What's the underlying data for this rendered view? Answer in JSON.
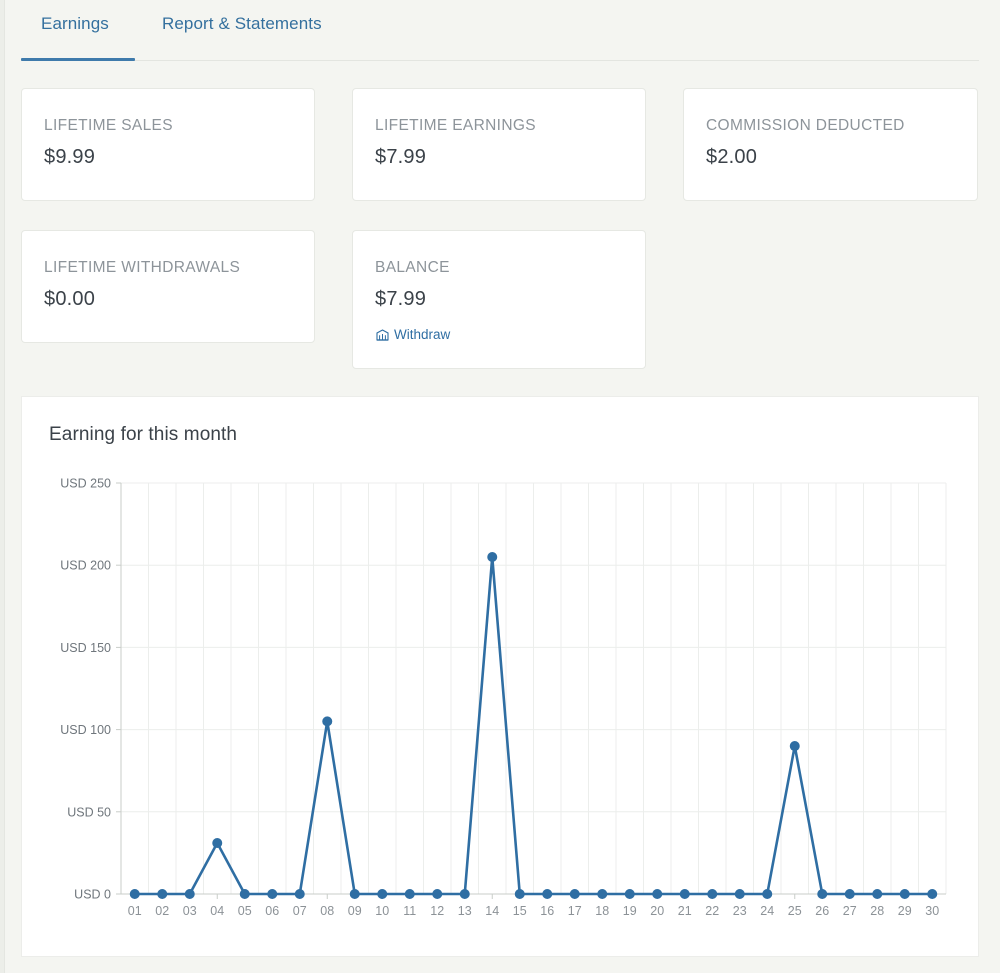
{
  "tabs": [
    {
      "id": "earnings",
      "label": "Earnings",
      "active": true
    },
    {
      "id": "report-statements",
      "label": "Report & Statements",
      "active": false
    }
  ],
  "cards": [
    {
      "id": "lifetime-sales",
      "label": "LIFETIME SALES",
      "value": "$9.99"
    },
    {
      "id": "lifetime-earnings",
      "label": "LIFETIME EARNINGS",
      "value": "$7.99"
    },
    {
      "id": "commission-deducted",
      "label": "COMMISSION DEDUCTED",
      "value": "$2.00"
    },
    {
      "id": "lifetime-withdrawals",
      "label": "LIFETIME WITHDRAWALS",
      "value": "$0.00"
    },
    {
      "id": "balance",
      "label": "BALANCE",
      "value": "$7.99",
      "action_label": "Withdraw",
      "action_icon": "withdraw-bank-icon"
    }
  ],
  "chart_data": {
    "type": "line",
    "title": "Earning for this month",
    "xlabel": "",
    "ylabel": "",
    "categories": [
      "01",
      "02",
      "03",
      "04",
      "05",
      "06",
      "07",
      "08",
      "09",
      "10",
      "11",
      "12",
      "13",
      "14",
      "15",
      "16",
      "17",
      "18",
      "19",
      "20",
      "21",
      "22",
      "23",
      "24",
      "25",
      "26",
      "27",
      "28",
      "29",
      "30"
    ],
    "values": [
      0,
      0,
      0,
      31,
      0,
      0,
      0,
      105,
      0,
      0,
      0,
      0,
      0,
      205,
      0,
      0,
      0,
      0,
      0,
      0,
      0,
      0,
      0,
      0,
      90,
      0,
      0,
      0,
      0,
      0
    ],
    "ytick_labels": [
      "USD 0",
      "USD 50",
      "USD 100",
      "USD 150",
      "USD 200",
      "USD 250"
    ],
    "ytick_values": [
      0,
      50,
      100,
      150,
      200,
      250
    ],
    "ylim": [
      0,
      250
    ],
    "grid": true,
    "legend": false,
    "series_color": "#2f6ea3",
    "marker_color": "#2f6ea3"
  },
  "colors": {
    "accent": "#3e7aab",
    "link": "#2f6ea3",
    "page_bg": "#f4f5f1",
    "card_bg": "#ffffff",
    "label_text": "#8d949a",
    "value_text": "#3b4249"
  }
}
